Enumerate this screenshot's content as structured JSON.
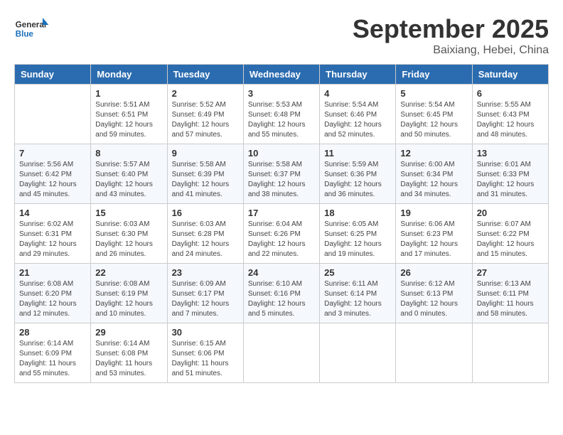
{
  "logo": {
    "general": "General",
    "blue": "Blue"
  },
  "title": "September 2025",
  "subtitle": "Baixiang, Hebei, China",
  "days_of_week": [
    "Sunday",
    "Monday",
    "Tuesday",
    "Wednesday",
    "Thursday",
    "Friday",
    "Saturday"
  ],
  "weeks": [
    [
      {
        "day": "",
        "info": ""
      },
      {
        "day": "1",
        "info": "Sunrise: 5:51 AM\nSunset: 6:51 PM\nDaylight: 12 hours\nand 59 minutes."
      },
      {
        "day": "2",
        "info": "Sunrise: 5:52 AM\nSunset: 6:49 PM\nDaylight: 12 hours\nand 57 minutes."
      },
      {
        "day": "3",
        "info": "Sunrise: 5:53 AM\nSunset: 6:48 PM\nDaylight: 12 hours\nand 55 minutes."
      },
      {
        "day": "4",
        "info": "Sunrise: 5:54 AM\nSunset: 6:46 PM\nDaylight: 12 hours\nand 52 minutes."
      },
      {
        "day": "5",
        "info": "Sunrise: 5:54 AM\nSunset: 6:45 PM\nDaylight: 12 hours\nand 50 minutes."
      },
      {
        "day": "6",
        "info": "Sunrise: 5:55 AM\nSunset: 6:43 PM\nDaylight: 12 hours\nand 48 minutes."
      }
    ],
    [
      {
        "day": "7",
        "info": "Sunrise: 5:56 AM\nSunset: 6:42 PM\nDaylight: 12 hours\nand 45 minutes."
      },
      {
        "day": "8",
        "info": "Sunrise: 5:57 AM\nSunset: 6:40 PM\nDaylight: 12 hours\nand 43 minutes."
      },
      {
        "day": "9",
        "info": "Sunrise: 5:58 AM\nSunset: 6:39 PM\nDaylight: 12 hours\nand 41 minutes."
      },
      {
        "day": "10",
        "info": "Sunrise: 5:58 AM\nSunset: 6:37 PM\nDaylight: 12 hours\nand 38 minutes."
      },
      {
        "day": "11",
        "info": "Sunrise: 5:59 AM\nSunset: 6:36 PM\nDaylight: 12 hours\nand 36 minutes."
      },
      {
        "day": "12",
        "info": "Sunrise: 6:00 AM\nSunset: 6:34 PM\nDaylight: 12 hours\nand 34 minutes."
      },
      {
        "day": "13",
        "info": "Sunrise: 6:01 AM\nSunset: 6:33 PM\nDaylight: 12 hours\nand 31 minutes."
      }
    ],
    [
      {
        "day": "14",
        "info": "Sunrise: 6:02 AM\nSunset: 6:31 PM\nDaylight: 12 hours\nand 29 minutes."
      },
      {
        "day": "15",
        "info": "Sunrise: 6:03 AM\nSunset: 6:30 PM\nDaylight: 12 hours\nand 26 minutes."
      },
      {
        "day": "16",
        "info": "Sunrise: 6:03 AM\nSunset: 6:28 PM\nDaylight: 12 hours\nand 24 minutes."
      },
      {
        "day": "17",
        "info": "Sunrise: 6:04 AM\nSunset: 6:26 PM\nDaylight: 12 hours\nand 22 minutes."
      },
      {
        "day": "18",
        "info": "Sunrise: 6:05 AM\nSunset: 6:25 PM\nDaylight: 12 hours\nand 19 minutes."
      },
      {
        "day": "19",
        "info": "Sunrise: 6:06 AM\nSunset: 6:23 PM\nDaylight: 12 hours\nand 17 minutes."
      },
      {
        "day": "20",
        "info": "Sunrise: 6:07 AM\nSunset: 6:22 PM\nDaylight: 12 hours\nand 15 minutes."
      }
    ],
    [
      {
        "day": "21",
        "info": "Sunrise: 6:08 AM\nSunset: 6:20 PM\nDaylight: 12 hours\nand 12 minutes."
      },
      {
        "day": "22",
        "info": "Sunrise: 6:08 AM\nSunset: 6:19 PM\nDaylight: 12 hours\nand 10 minutes."
      },
      {
        "day": "23",
        "info": "Sunrise: 6:09 AM\nSunset: 6:17 PM\nDaylight: 12 hours\nand 7 minutes."
      },
      {
        "day": "24",
        "info": "Sunrise: 6:10 AM\nSunset: 6:16 PM\nDaylight: 12 hours\nand 5 minutes."
      },
      {
        "day": "25",
        "info": "Sunrise: 6:11 AM\nSunset: 6:14 PM\nDaylight: 12 hours\nand 3 minutes."
      },
      {
        "day": "26",
        "info": "Sunrise: 6:12 AM\nSunset: 6:13 PM\nDaylight: 12 hours\nand 0 minutes."
      },
      {
        "day": "27",
        "info": "Sunrise: 6:13 AM\nSunset: 6:11 PM\nDaylight: 11 hours\nand 58 minutes."
      }
    ],
    [
      {
        "day": "28",
        "info": "Sunrise: 6:14 AM\nSunset: 6:09 PM\nDaylight: 11 hours\nand 55 minutes."
      },
      {
        "day": "29",
        "info": "Sunrise: 6:14 AM\nSunset: 6:08 PM\nDaylight: 11 hours\nand 53 minutes."
      },
      {
        "day": "30",
        "info": "Sunrise: 6:15 AM\nSunset: 6:06 PM\nDaylight: 11 hours\nand 51 minutes."
      },
      {
        "day": "",
        "info": ""
      },
      {
        "day": "",
        "info": ""
      },
      {
        "day": "",
        "info": ""
      },
      {
        "day": "",
        "info": ""
      }
    ]
  ]
}
